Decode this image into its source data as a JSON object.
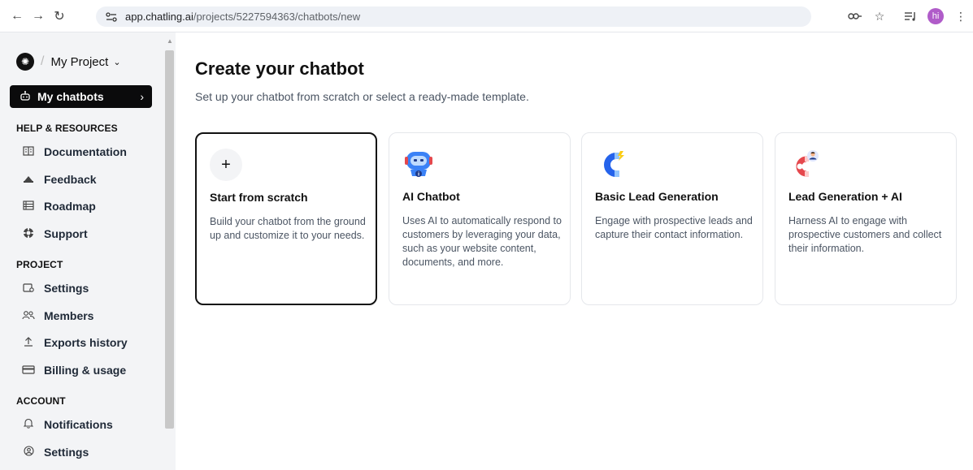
{
  "browser": {
    "url_host": "app.chatling.ai",
    "url_path": "/projects/5227594363/chatbots/new",
    "avatar_initials": "hi"
  },
  "sidebar": {
    "project_name": "My Project",
    "my_chatbots_label": "My chatbots",
    "help_heading": "HELP & RESOURCES",
    "help_items": [
      {
        "label": "Documentation",
        "icon": "book-icon"
      },
      {
        "label": "Feedback",
        "icon": "megaphone-icon"
      },
      {
        "label": "Roadmap",
        "icon": "list-icon"
      },
      {
        "label": "Support",
        "icon": "lifebuoy-icon"
      }
    ],
    "project_heading": "PROJECT",
    "project_items": [
      {
        "label": "Settings",
        "icon": "settings-icon"
      },
      {
        "label": "Members",
        "icon": "members-icon"
      },
      {
        "label": "Exports history",
        "icon": "upload-icon"
      },
      {
        "label": "Billing & usage",
        "icon": "card-icon"
      }
    ],
    "account_heading": "ACCOUNT",
    "account_items": [
      {
        "label": "Notifications",
        "icon": "bell-icon"
      },
      {
        "label": "Settings",
        "icon": "user-settings-icon"
      }
    ]
  },
  "main": {
    "title": "Create your chatbot",
    "subtitle": "Set up your chatbot from scratch or select a ready-made template.",
    "cards": [
      {
        "title": "Start from scratch",
        "desc": "Build your chatbot from the ground up and customize it to your needs.",
        "icon": "plus-icon"
      },
      {
        "title": "AI Chatbot",
        "desc": "Uses AI to automatically respond to customers by leveraging your data, such as your website content, documents, and more.",
        "icon": "robot-icon"
      },
      {
        "title": "Basic Lead Generation",
        "desc": "Engage with prospective leads and capture their contact information.",
        "icon": "magnet-icon"
      },
      {
        "title": "Lead Generation + AI",
        "desc": "Harness AI to engage with prospective customers and collect their information.",
        "icon": "magnet-person-icon"
      }
    ]
  },
  "colors": {
    "accent_dark": "#0b0b0c",
    "sidebar_bg": "#f3f4f6",
    "robot_blue": "#3b82f6",
    "magnet_red": "#e5484d"
  }
}
